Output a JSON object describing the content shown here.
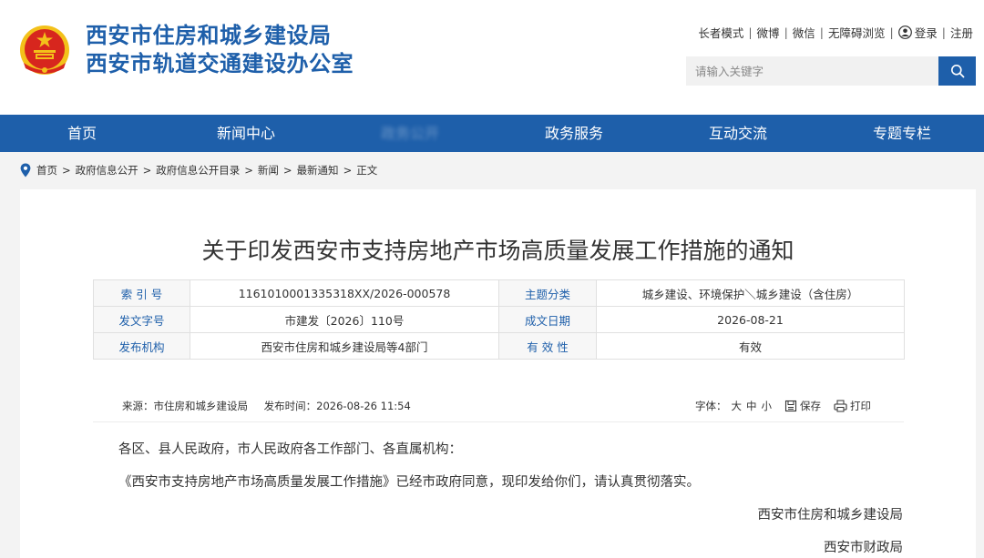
{
  "header": {
    "org_line1": "西安市住房和城乡建设局",
    "org_line2": "西安市轨道交通建设办公室",
    "top_links": [
      "长者模式",
      "微博",
      "微信",
      "无障碍浏览"
    ],
    "login": "登录",
    "register": "注册",
    "search": {
      "placeholder": "请输入关键字"
    }
  },
  "nav": {
    "items": [
      "首页",
      "新闻中心",
      "政务公开",
      "政务服务",
      "互动交流",
      "专题专栏"
    ]
  },
  "breadcrumb": [
    "首页",
    "政府信息公开",
    "政府信息公开目录",
    "新闻",
    "最新通知",
    "正文"
  ],
  "article": {
    "title": "关于印发西安市支持房地产市场高质量发展工作措施的通知",
    "meta": [
      {
        "k1": "索 引 号",
        "v1": "1161010001335318XX/2026-000578",
        "k2": "主题分类",
        "v2": "城乡建设、环境保护＼城乡建设（含住房）"
      },
      {
        "k1": "发文字号",
        "v1": "市建发〔2026〕110号",
        "k2": "成文日期",
        "v2": "2026-08-21"
      },
      {
        "k1": "发布机构",
        "v1": "西安市住房和城乡建设局等4部门",
        "k2": "有 效 性",
        "v2": "有效"
      }
    ],
    "source": "来源：市住房和城乡建设局",
    "publish_time": "发布时间：2026-08-26 11:54",
    "font_size_label": "字体：",
    "font_sizes": [
      "大",
      "中",
      "小"
    ],
    "save": "保存",
    "print": "打印",
    "salutation": "各区、县人民政府，市人民政府各工作部门、各直属机构：",
    "paragraph": "《西安市支持房地产市场高质量发展工作措施》已经市政府同意，现印发给你们，请认真贯彻落实。",
    "signatures": [
      "西安市住房和城乡建设局",
      "西安市财政局"
    ]
  },
  "colors": {
    "brand_blue": "#1e5faa",
    "emblem_red": "#d7261e",
    "emblem_gold": "#f3c11a"
  }
}
